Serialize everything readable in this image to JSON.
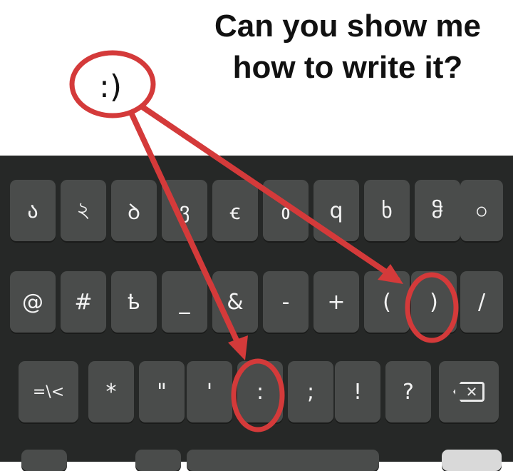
{
  "caption": {
    "line1": "Can you show me",
    "line2": "how to write it?"
  },
  "emoticon": ":)",
  "keyboard": {
    "row1": [
      "ა",
      "২",
      "ꝺ",
      "ვ",
      "ꞓ",
      "ᲂ",
      "q",
      "ხ",
      "ჵ",
      "ဝ"
    ],
    "row2": [
      "@",
      "#",
      "ҍ",
      "_",
      "&",
      "-",
      "+",
      "(",
      ")",
      "/"
    ],
    "row3": [
      "=\\<",
      "*",
      "\"",
      "'",
      ":",
      ";",
      "!",
      "?"
    ],
    "backspace_icon": "backspace-icon",
    "backspace_glyph": "✕"
  },
  "colors": {
    "annotation": "#d43a3a",
    "keyboard_bg": "#262827",
    "key_bg": "#4a4c4b"
  }
}
